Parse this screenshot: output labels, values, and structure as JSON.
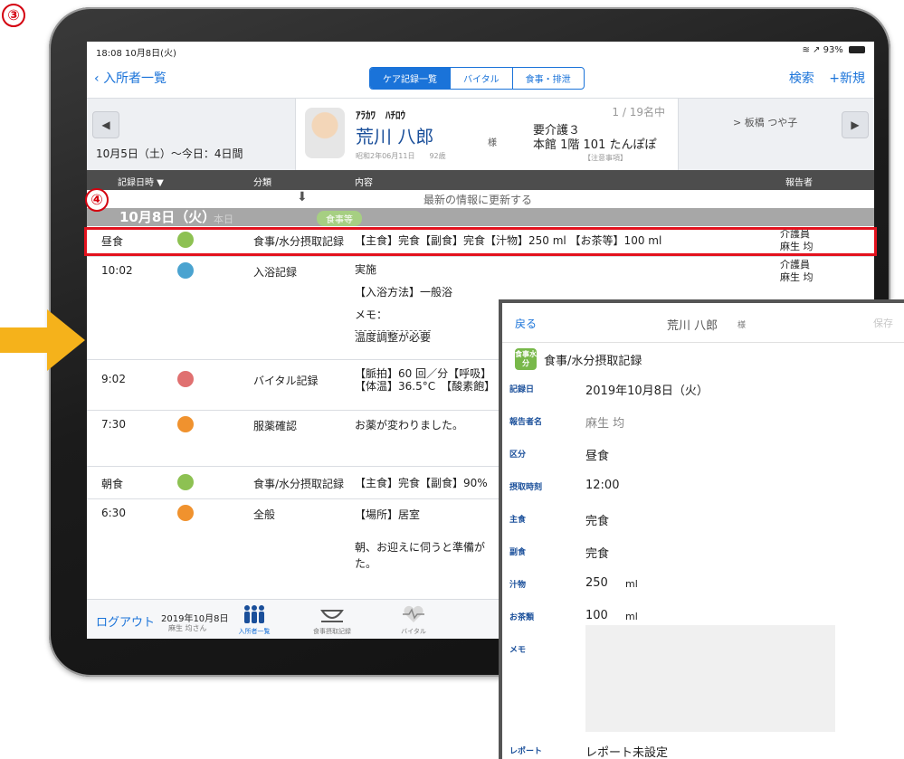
{
  "annotations": {
    "step3": "③",
    "step4": "④"
  },
  "statusbar": {
    "time": "18:08  10月8日(火)",
    "battery": "93%"
  },
  "nav": {
    "back_label": "入所者一覧",
    "segments": [
      {
        "label": "ケア記録一覧",
        "active": true
      },
      {
        "label": "バイタル",
        "active": false
      },
      {
        "label": "食事・排泄",
        "active": false
      }
    ],
    "search_label": "検索",
    "new_label": "+新規"
  },
  "resident": {
    "prev_glyph": "◀",
    "next_glyph": "▶",
    "period": "10月5日（土）～今日：4日間",
    "kana": "ｱﾗｶﾜ　ﾊﾁﾛｳ",
    "name": "荒川 八郎",
    "honorific": "様",
    "dob": "昭和2年06月11日　　92歳",
    "care_level": "要介護３",
    "room": "本館 1階 101 たんぽぽ",
    "count": "1 / 19名中",
    "notes": "【注意事項】",
    "next_name": "> 板橋 つや子"
  },
  "table": {
    "headers": {
      "datetime": "記録日時 ▼",
      "category": "分類",
      "content": "内容",
      "reporter": "報告者"
    },
    "refresh_label": "最新の情報に更新する",
    "date_title": "10月8日（火）",
    "date_today": "本日",
    "date_chip": "食事等",
    "rows": [
      {
        "time": "昼食",
        "color": "#8dc152",
        "category": "食事/水分摂取記録",
        "lines": [
          "【主食】完食【副食】完食【汁物】250 ml 【お茶等】100 ml"
        ],
        "reporter_role": "介護員",
        "reporter_name": "麻生 均"
      },
      {
        "time": "10:02",
        "color": "#4aa3d0",
        "category": "入浴記録",
        "lines": [
          "実施",
          "【入浴方法】一般浴",
          "メモ：",
          "温度調整が必要"
        ],
        "reporter_role": "介護員",
        "reporter_name": "麻生 均"
      },
      {
        "time": "9:02",
        "color": "#e07070",
        "category": "バイタル記録",
        "lines": [
          "【脈拍】60 回／分【呼吸】",
          "【体温】36.5°C　【酸素飽】"
        ],
        "reporter_role": "",
        "reporter_name": ""
      },
      {
        "time": "7:30",
        "color": "#f0922e",
        "category": "服薬確認",
        "lines": [
          "お薬が変わりました。"
        ],
        "reporter_role": "",
        "reporter_name": ""
      },
      {
        "time": "朝食",
        "color": "#8dc152",
        "category": "食事/水分摂取記録",
        "lines": [
          "【主食】完食【副食】90%"
        ],
        "reporter_role": "",
        "reporter_name": ""
      },
      {
        "time": "6:30",
        "color": "#f0922e",
        "category": "全般",
        "lines": [
          "【場所】居室",
          "朝、お迎えに伺うと準備が",
          "た。"
        ],
        "reporter_role": "",
        "reporter_name": ""
      }
    ]
  },
  "tabbar": {
    "logout_label": "ログアウト",
    "date": "2019年10月8日",
    "user": "麻生 均さん",
    "tabs": [
      {
        "label": "入所者一覧",
        "active": true
      },
      {
        "label": "食事摂取記録",
        "active": false
      },
      {
        "label": "バイタル",
        "active": false
      }
    ]
  },
  "popup": {
    "back_label": "戻る",
    "resident_name": "荒川 八郎",
    "honorific": "様",
    "save_label": "保存",
    "badge": "食事水分",
    "title": "食事/水分摂取記録",
    "fields": {
      "date": {
        "label": "記録日",
        "value": "2019年10月8日（火）"
      },
      "reporter": {
        "label": "報告者名",
        "value": "麻生 均"
      },
      "meal_type": {
        "label": "区分",
        "value": "昼食"
      },
      "intake_time": {
        "label": "摂取時刻",
        "value": "12:00"
      },
      "staple": {
        "label": "主食",
        "value": "完食"
      },
      "side": {
        "label": "副食",
        "value": "完食"
      },
      "soup": {
        "label": "汁物",
        "value": "250",
        "unit": "ml"
      },
      "tea": {
        "label": "お茶類",
        "value": "100",
        "unit": "ml"
      },
      "memo": {
        "label": "メモ"
      },
      "report": {
        "label": "レポート",
        "value": "レポート未設定"
      }
    }
  }
}
